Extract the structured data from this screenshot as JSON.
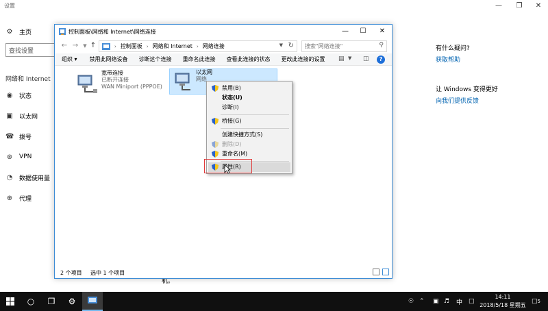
{
  "settings": {
    "title": "设置",
    "nav": {
      "home": "主页",
      "search_placeholder": "查找设置",
      "section": "网络和 Internet",
      "items": [
        "状态",
        "以太网",
        "拨号",
        "VPN",
        "数据使用量",
        "代理"
      ]
    },
    "right": {
      "question": "有什么疑问?",
      "help_link": "获取帮助",
      "improve": "让 Windows 变得更好",
      "feedback_link": "向我们提供反馈"
    },
    "stray": "机。"
  },
  "explorer": {
    "title": "控制面板\\网络和 Internet\\网络连接",
    "breadcrumb": [
      "控制面板",
      "网络和 Internet",
      "网络连接"
    ],
    "search_placeholder": "搜索\"网络连接\"",
    "commands": [
      "组织 ▾",
      "禁用此网络设备",
      "诊断这个连接",
      "重命名此连接",
      "查看此连接的状态",
      "更改此连接的设置"
    ],
    "connections": [
      {
        "name": "宽带连接",
        "status": "已断开连接",
        "device": "WAN Miniport (PPPOE)"
      },
      {
        "name": "以太网",
        "status": "网络",
        "device": ""
      }
    ],
    "status_bar": {
      "count": "2 个项目",
      "selected": "选中 1 个项目"
    }
  },
  "context_menu": {
    "items": [
      {
        "label": "禁用(B)",
        "shield": true
      },
      {
        "label": "状态(U)",
        "bold": true
      },
      {
        "label": "诊断(I)"
      },
      {
        "label": "桥接(G)",
        "shield": true
      },
      {
        "label": "创建快捷方式(S)"
      },
      {
        "label": "删除(D)",
        "shield": true,
        "disabled": true
      },
      {
        "label": "重命名(M)",
        "shield": true
      },
      {
        "label": "属性(R)",
        "shield": true,
        "hover": true
      }
    ]
  },
  "taskbar": {
    "ime": "中",
    "time": "14:11",
    "date": "2018/5/18 星期五",
    "notification_count": "5"
  }
}
